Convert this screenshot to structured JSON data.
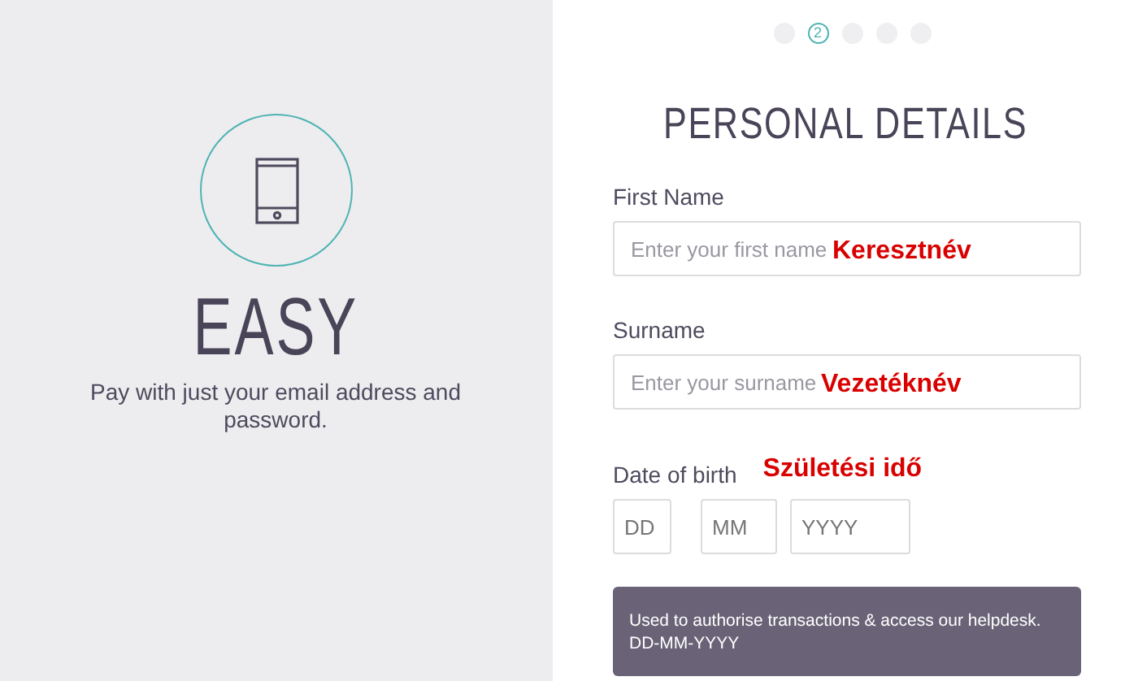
{
  "promo": {
    "title": "EASY",
    "text": "Pay with just your email address and password."
  },
  "steps": [
    {
      "selected": false
    },
    {
      "selected": true,
      "label": "2"
    },
    {
      "selected": false
    },
    {
      "selected": false
    },
    {
      "selected": false
    }
  ],
  "heading": "PERSONAL DETAILS",
  "fields": [
    {
      "label": "First Name",
      "placeholder": "Enter your first name",
      "annotation": "Keresztnév"
    },
    {
      "label": "Surname",
      "placeholder": "Enter your surname",
      "annotation": "Vezetéknév"
    }
  ],
  "date_of_birth": {
    "label": "Date of birth",
    "annotation": "Születési idő",
    "parts": [
      {
        "placeholder": "DD"
      },
      {
        "placeholder": "MM"
      },
      {
        "placeholder": "YYYY"
      }
    ]
  },
  "info": [
    "Used to authorise transactions & access our helpdesk.",
    "DD-MM-YYYY"
  ]
}
